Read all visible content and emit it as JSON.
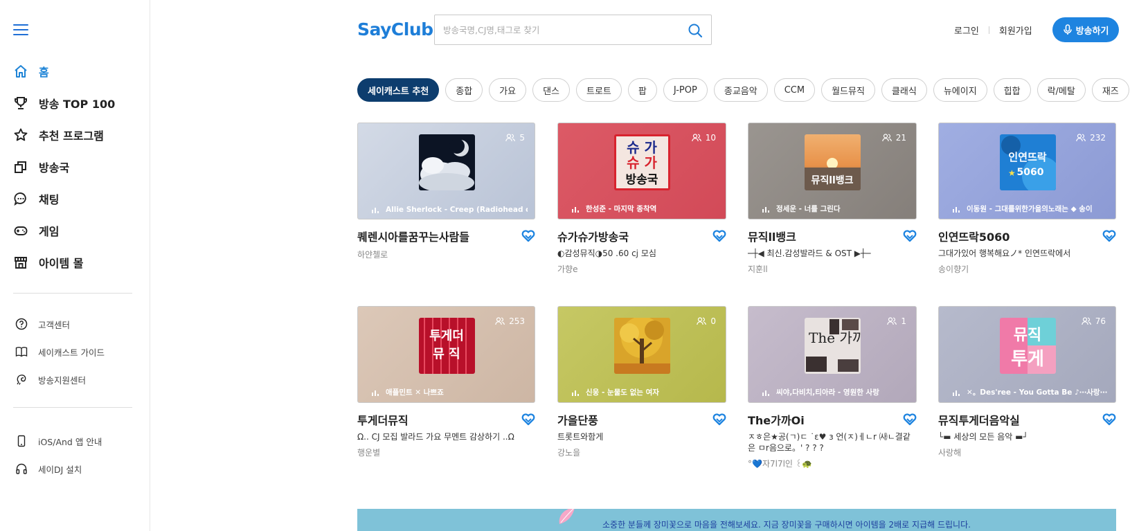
{
  "sidebar": {
    "main_items": [
      {
        "label": "홈",
        "icon": "home-icon",
        "active": true
      },
      {
        "label": "방송 TOP 100",
        "icon": "trophy-icon",
        "active": false
      },
      {
        "label": "추천 프로그램",
        "icon": "star-icon",
        "active": false
      },
      {
        "label": "방송국",
        "icon": "stations-icon",
        "active": false
      },
      {
        "label": "채팅",
        "icon": "chat-icon",
        "active": false
      },
      {
        "label": "게임",
        "icon": "gamepad-icon",
        "active": false
      },
      {
        "label": "아이템 몰",
        "icon": "shop-icon",
        "active": false
      }
    ],
    "support_items": [
      {
        "label": "고객센터",
        "icon": "help-icon"
      },
      {
        "label": "세이캐스트 가이드",
        "icon": "book-icon"
      },
      {
        "label": "방송지원센터",
        "icon": "support-icon"
      }
    ],
    "app_items": [
      {
        "label": "iOS/And 앱 안내",
        "icon": "phone-icon"
      },
      {
        "label": "세이DJ 설치",
        "icon": "headphones-icon"
      }
    ]
  },
  "header": {
    "logo": "SayClub",
    "search_placeholder": "방송국명,CJ명,태그로 찾기",
    "login": "로그인",
    "signup": "회원가입",
    "broadcast_button": "방송하기"
  },
  "genre_tabs": [
    "세이캐스트 추천",
    "종합",
    "가요",
    "댄스",
    "트로트",
    "팝",
    "J-POP",
    "종교음악",
    "CCM",
    "월드뮤직",
    "클래식",
    "뉴에이지",
    "힙합",
    "락/메탈",
    "재즈"
  ],
  "active_tab": 0,
  "cards": [
    {
      "title": "퀘렌시아를꿈꾸는사람들",
      "desc": "",
      "owner": "하얀첼로",
      "listeners": "5",
      "now_playing": "Allie Sherlock - Creep (Radiohead co...",
      "bg": "#c5cede",
      "art": "clouds"
    },
    {
      "title": "슈가슈가방송국",
      "desc": "◐감성뮤직◑50 .60 cj 모심",
      "owner": "가향e",
      "listeners": "10",
      "now_playing": "한성준 - 마지막 종착역",
      "bg": "#d9505f",
      "art": "sugar",
      "art_text_1": "슈 가",
      "art_text_2": "슈 가",
      "art_text_3": "방송국"
    },
    {
      "title": "뮤직ll뱅크",
      "desc": "─┼◀ 최신.감성발라드 & OST ▶┼─",
      "owner": "지훈ll",
      "listeners": "21",
      "now_playing": "정세운 - 너를 그린다",
      "bg": "#8d8884",
      "art": "sunset",
      "art_text": "뮤직ll뱅크"
    },
    {
      "title": "인연뜨락5060",
      "desc": "그대가있어 행복해요ノ* 인연뜨락에서",
      "owner": "송이향기",
      "listeners": "232",
      "now_playing": "이동원 - 그대를위한가을의노래는 ◆ 송이",
      "bg": "#96a6dc",
      "art": "notes",
      "art_text_1": "인연뜨락",
      "art_text_2": "5060"
    },
    {
      "title": "투게더뮤직",
      "desc": "Ω.. CJ 모집 발라드 가요 무멘트 감상하기 ..Ω",
      "owner": "행운별",
      "listeners": "253",
      "now_playing": "애플민트 ✕ 나쁘죠",
      "bg": "#d5c0b0",
      "art": "together",
      "art_text_1": "투게더",
      "art_text_2": "뮤 직"
    },
    {
      "title": "가을단풍",
      "desc": "트롯트와함게",
      "owner": "강노을",
      "listeners": "0",
      "now_playing": "신웅 - 눈물도 없는 여자",
      "bg": "#bfc258",
      "art": "tree"
    },
    {
      "title": "The가까Oi",
      "desc": "ㅈㅎ은★공(ㄱ)ㄷ ˙ε♥ з 언(ㅈ)ㅔㄴr ㈔ㄴ결같은 ㅁr음으로。' ? ? ?",
      "owner": "°💙자7l7l인 ꒰🐢",
      "listeners": "1",
      "now_playing": "씨야,다비치,티아라 - 영원한 사랑",
      "bg": "#bdb4c4",
      "art": "collage",
      "art_text": "The 가까이"
    },
    {
      "title": "뮤직투게더음악실",
      "desc": "└▬ 세상의 모든 음악 ▬┘",
      "owner": "사랑해",
      "listeners": "76",
      "now_playing": "✕。Des'ree - You Gotta Be ♪⋯사랑⋯",
      "bg": "#adb2c6",
      "art": "music",
      "art_text_1": "뮤직",
      "art_text_2": "투게"
    }
  ],
  "banner": {
    "text": "소중한 분들께 장미꽃으로 마음을 전해보세요. 지금 장미꽃을 구매하시면 아이템을 2배로 지급해 드립니다."
  },
  "colors": {
    "accent": "#1e84e0",
    "active_tab": "#0d3d6e",
    "nav_active": "#1f84d6"
  }
}
